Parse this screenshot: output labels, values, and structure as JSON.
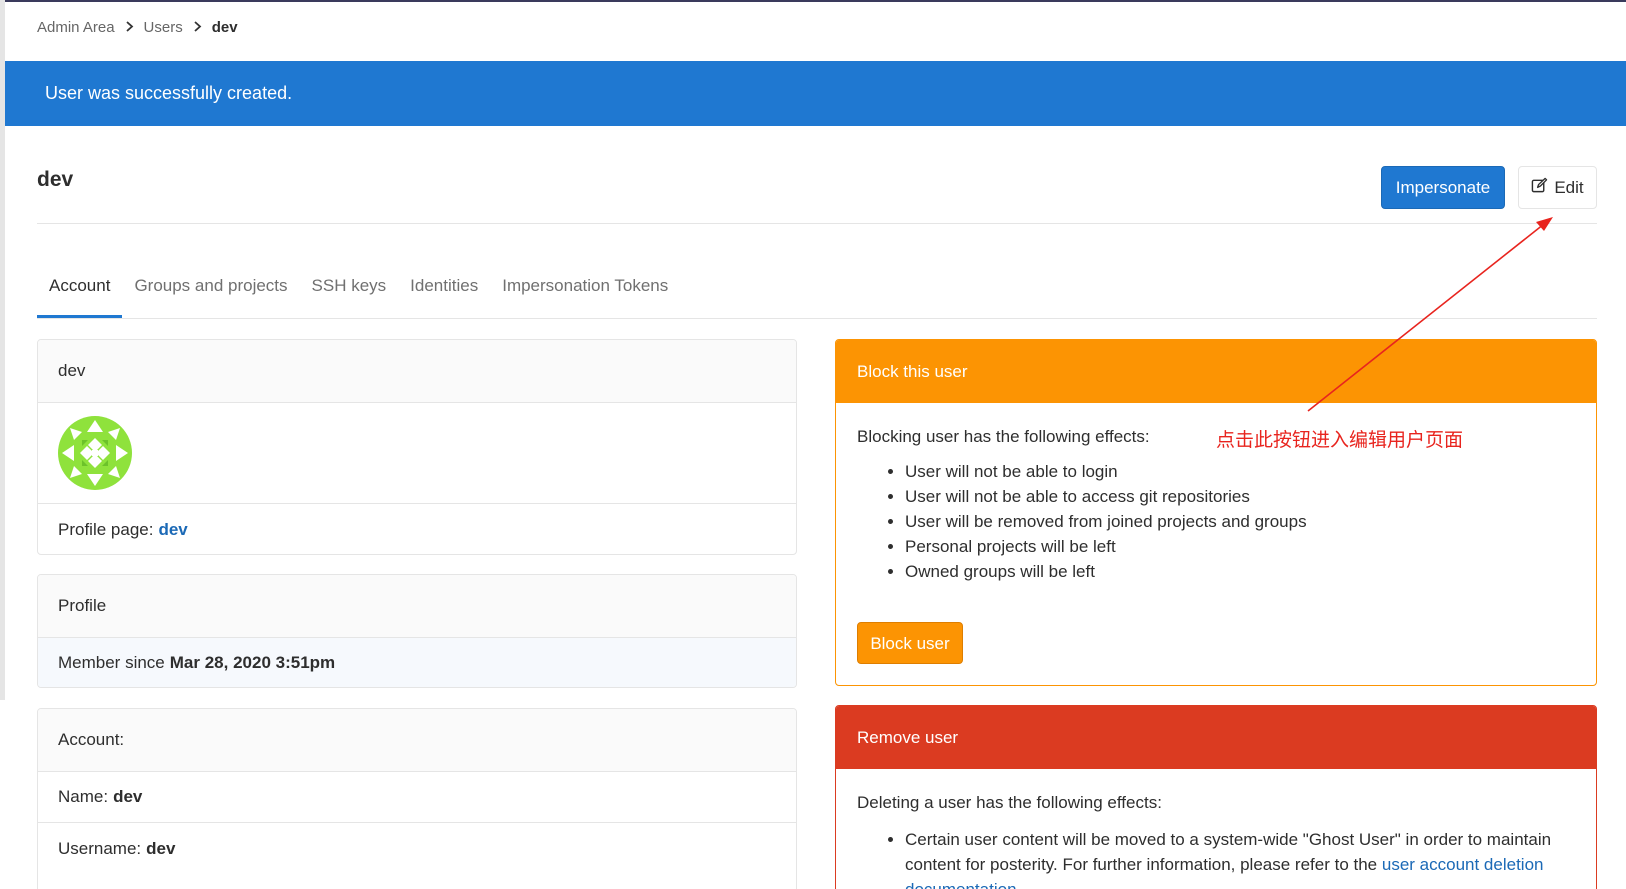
{
  "breadcrumb": {
    "items": [
      "Admin Area",
      "Users"
    ],
    "current": "dev"
  },
  "flash": {
    "message": "User was successfully created."
  },
  "header": {
    "title": "dev",
    "impersonate_label": "Impersonate",
    "edit_label": "Edit"
  },
  "tabs": [
    {
      "label": "Account",
      "active": true
    },
    {
      "label": "Groups and projects",
      "active": false
    },
    {
      "label": "SSH keys",
      "active": false
    },
    {
      "label": "Identities",
      "active": false
    },
    {
      "label": "Impersonation Tokens",
      "active": false
    }
  ],
  "user_card": {
    "title": "dev",
    "profile_page_label": "Profile page:",
    "profile_page_link": "dev"
  },
  "profile_card": {
    "title": "Profile",
    "member_since_label": "Member since",
    "member_since_value": "Mar 28, 2020 3:51pm"
  },
  "account_card": {
    "title": "Account:",
    "name_label": "Name:",
    "name_value": "dev",
    "username_label": "Username:",
    "username_value": "dev"
  },
  "block_panel": {
    "title": "Block this user",
    "intro": "Blocking user has the following effects:",
    "effects": [
      "User will not be able to login",
      "User will not be able to access git repositories",
      "User will be removed from joined projects and groups",
      "Personal projects will be left",
      "Owned groups will be left"
    ],
    "button_label": "Block user",
    "color": "#fc9403"
  },
  "remove_panel": {
    "title": "Remove user",
    "intro": "Deleting a user has the following effects:",
    "effect_text": "Certain user content will be moved to a system-wide \"Ghost User\" in order to maintain content for posterity. For further information, please refer to the",
    "effect_link": "user account deletion documentation.",
    "color": "#db3b21"
  },
  "annotation": {
    "text": "点击此按钮进入编辑用户页面",
    "color": "#e8241e"
  },
  "colors": {
    "primary": "#1f78d1",
    "warning": "#fc9403",
    "danger": "#db3b21",
    "avatar": "#8fe23c"
  },
  "icons": {
    "breadcrumb_separator": "chevron-right-icon",
    "edit": "pencil-square-icon",
    "avatar": "identicon"
  }
}
